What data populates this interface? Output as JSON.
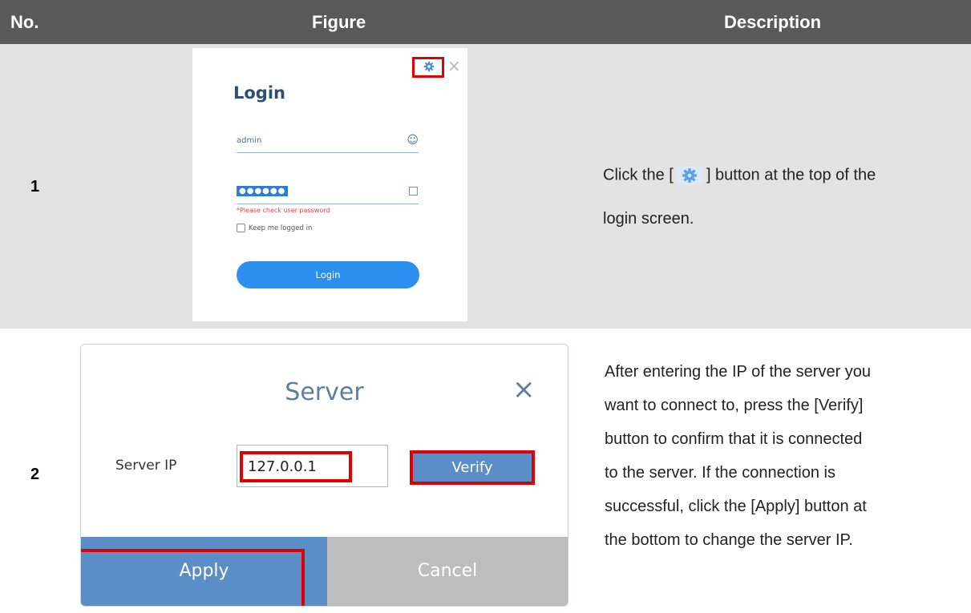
{
  "table": {
    "headers": {
      "no": "No.",
      "figure": "Figure",
      "description": "Description"
    },
    "rows": [
      {
        "no": "1",
        "description_line1_pre": "Click the [",
        "description_line1_post": "] button at the top of the",
        "description_line2": "login screen."
      },
      {
        "no": "2",
        "description_lines": [
          "After entering the IP of the server you",
          "want to connect to, press the [Verify]",
          "button to confirm that it is connected",
          "to the server. If the connection is",
          "successful, click the [Apply] button at",
          "the bottom to change the server IP."
        ]
      }
    ]
  },
  "login_figure": {
    "title": "Login",
    "username": "admin",
    "password_mask": "●●●●●●",
    "error": "*Please check user password",
    "keep_logged_in": "Keep me logged in",
    "button": "Login",
    "close": "×"
  },
  "server_figure": {
    "title": "Server",
    "close": "×",
    "ip_label": "Server IP",
    "ip_value": "127.0.0.1",
    "verify": "Verify",
    "apply": "Apply",
    "cancel": "Cancel"
  },
  "colors": {
    "header_bg": "#595959",
    "row1_bg": "#e3e3e3",
    "accent_blue": "#2c8ff0",
    "highlight_red": "#e00000"
  }
}
